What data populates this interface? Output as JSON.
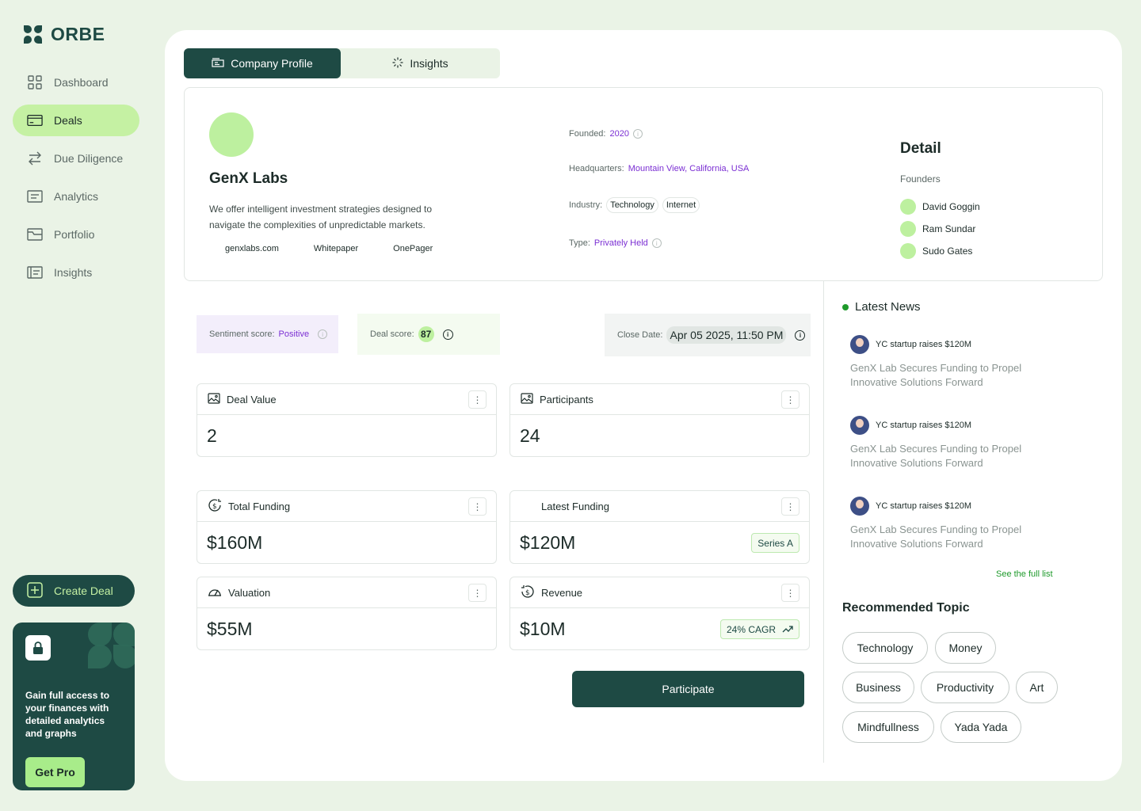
{
  "brand": {
    "name": "ORBE"
  },
  "sidebar": {
    "items": [
      {
        "label": "Dashboard",
        "icon": "grid-icon"
      },
      {
        "label": "Deals",
        "icon": "card-icon"
      },
      {
        "label": "Due Diligence",
        "icon": "swap-icon"
      },
      {
        "label": "Analytics",
        "icon": "chart-icon"
      },
      {
        "label": "Portfolio",
        "icon": "folder-icon"
      },
      {
        "label": "Insights",
        "icon": "insights-icon"
      }
    ],
    "active": "Deals",
    "create_deal": "Create Deal",
    "promo": {
      "text": "Gain full access to your finances with detailed analytics and graphs",
      "button": "Get Pro"
    }
  },
  "tabs": [
    {
      "label": "Company Profile",
      "icon": "building-icon"
    },
    {
      "label": "Insights",
      "icon": "spinner-icon"
    }
  ],
  "company": {
    "name": "GenX Labs",
    "description": "We offer intelligent investment strategies designed to navigate the complexities of unpredictable markets.",
    "links": [
      "genxlabs.com",
      "Whitepaper",
      "OnePager"
    ],
    "founded_label": "Founded:",
    "founded": "2020",
    "hq_label": "Headquarters:",
    "hq": "Mountain View, California, USA",
    "industry_label": "Industry:",
    "industries": [
      "Technology",
      "Internet"
    ],
    "type_label": "Type:",
    "type": "Privately Held"
  },
  "detail": {
    "title": "Detail",
    "founders_label": "Founders",
    "founders": [
      "David Goggin",
      "Ram Sundar",
      "Sudo Gates"
    ]
  },
  "scores": {
    "sentiment_label": "Sentiment score:",
    "sentiment": "Positive",
    "deal_label": "Deal score:",
    "deal": "87",
    "close_label": "Close Date:",
    "close_date": "Apr 05 2025, 11:50 PM"
  },
  "cards": [
    {
      "title": "Deal Value",
      "value": "2",
      "icon": "image-icon"
    },
    {
      "title": "Participants",
      "value": "24",
      "icon": "image-icon"
    },
    {
      "title": "Total Funding",
      "value": "$160M",
      "icon": "dollar-circle-icon"
    },
    {
      "title": "Latest Funding",
      "value": "$120M",
      "tag": "Series A"
    },
    {
      "title": "Valuation",
      "value": "$55M",
      "icon": "gauge-icon"
    },
    {
      "title": "Revenue",
      "value": "$10M",
      "icon": "dollar-refresh-icon",
      "tag": "24% CAGR"
    }
  ],
  "participate": "Participate",
  "news": {
    "title": "Latest News",
    "items": [
      {
        "source": "YC startup raises $120M",
        "title": "GenX Lab Secures Funding to Propel Innovative Solutions Forward"
      },
      {
        "source": "YC startup raises $120M",
        "title": "GenX Lab Secures Funding to Propel Innovative Solutions Forward"
      },
      {
        "source": "YC startup raises $120M",
        "title": "GenX Lab Secures Funding to Propel Innovative Solutions Forward"
      }
    ],
    "see_full": "See the full list"
  },
  "topics": {
    "title": "Recommended Topic",
    "items": [
      "Technology",
      "Money",
      "Business",
      "Productivity",
      "Art",
      "Mindfullness",
      "Yada Yada"
    ]
  },
  "colors": {
    "accent": "#1e4a44",
    "highlight": "#c5f1a3",
    "link": "#7b2fd3",
    "success": "#1e9a2b"
  }
}
